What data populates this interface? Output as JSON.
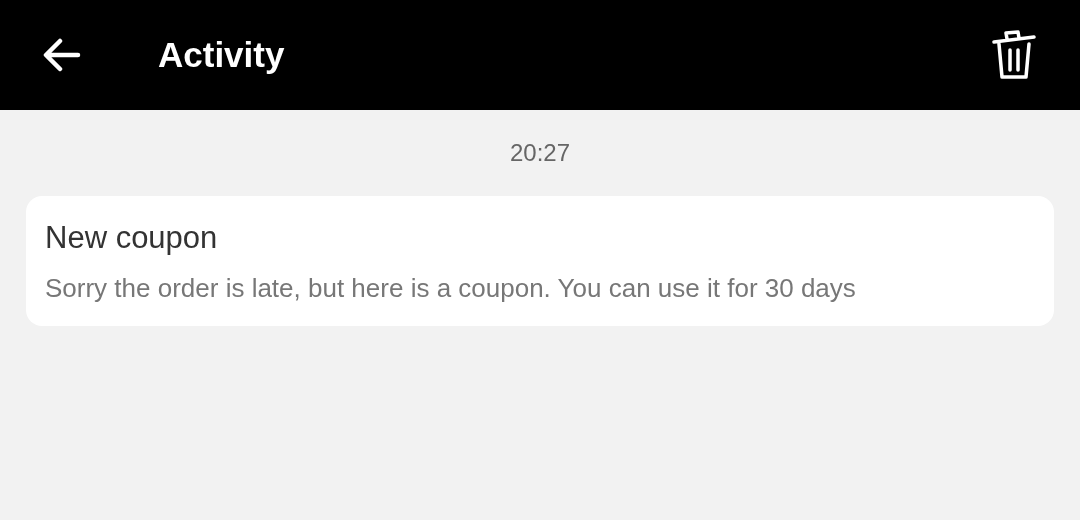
{
  "app_bar": {
    "title": "Activity"
  },
  "messages": [
    {
      "time": "20:27",
      "title": "New coupon",
      "body": "Sorry the order is late, but here is a coupon. You can use it for 30 days"
    }
  ]
}
